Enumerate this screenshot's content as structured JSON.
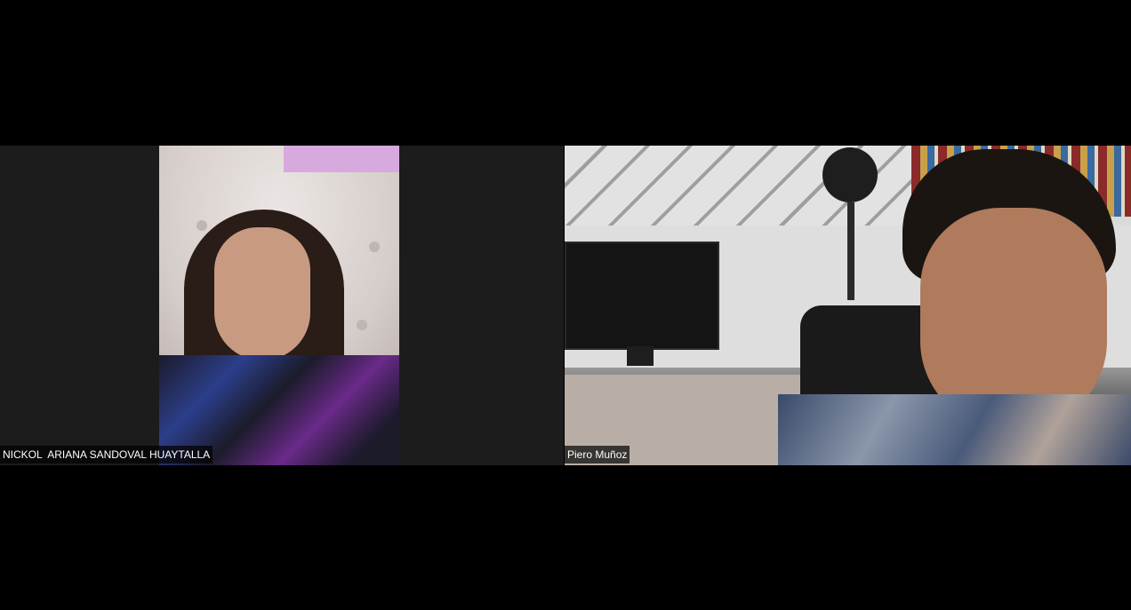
{
  "meeting": {
    "participants": [
      {
        "name": "NICKOL  ARIANA SANDOVAL HUAYTALLA"
      },
      {
        "name": "Piero Muñoz"
      }
    ]
  },
  "colors": {
    "background": "#000000",
    "tile_background": "#1c1c1c",
    "label_background": "#000000b3",
    "label_text": "#ffffff"
  }
}
